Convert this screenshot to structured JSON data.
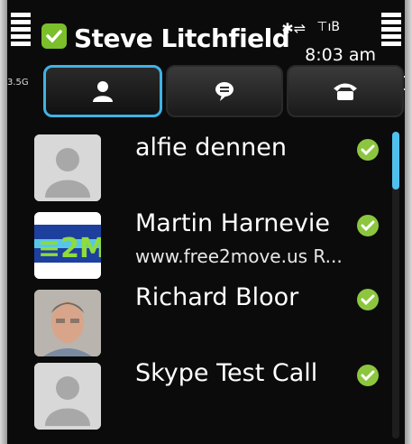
{
  "header": {
    "user_name": "Steve Litchfield",
    "time": "8:03 am",
    "bluetooth_icon": "bluetooth-icon",
    "network_icon": "network-status-icon"
  },
  "edge": {
    "left_label": "3.5G"
  },
  "tabs": [
    {
      "name": "contacts",
      "icon": "person-icon",
      "active": true
    },
    {
      "name": "chats",
      "icon": "chat-bubble-icon",
      "active": false
    },
    {
      "name": "calls",
      "icon": "phone-icon",
      "active": false
    }
  ],
  "contacts": [
    {
      "name": "alfie dennen",
      "subtitle": "",
      "avatar": "default-avatar",
      "status": "online"
    },
    {
      "name": "Martin Harnevie",
      "subtitle": "www.free2move.us R...",
      "avatar": "logo-avatar",
      "status": "online"
    },
    {
      "name": "Richard Bloor",
      "subtitle": "",
      "avatar": "photo-avatar",
      "status": "online"
    },
    {
      "name": "Skype Test Call",
      "subtitle": "",
      "avatar": "default-avatar",
      "status": "online"
    }
  ],
  "colors": {
    "accent": "#3fb3e6",
    "online": "#8cc63f",
    "background": "#0b0b0b"
  }
}
